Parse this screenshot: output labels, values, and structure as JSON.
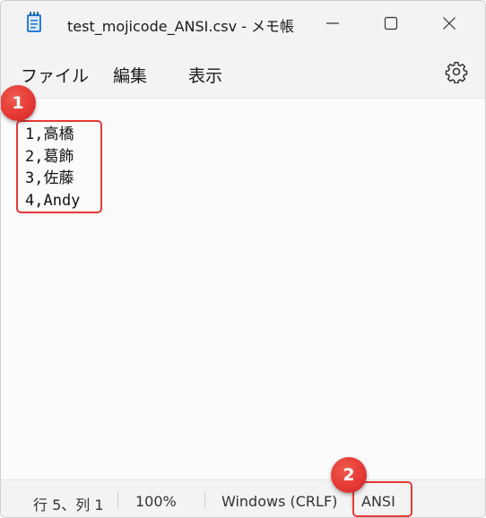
{
  "window": {
    "title": "test_mojicode_ANSI.csv - メモ帳",
    "app_icon": "notepad-icon",
    "controls": {
      "minimize_icon": "minimize-icon",
      "maximize_icon": "maximize-icon",
      "close_icon": "close-icon"
    }
  },
  "menu": {
    "items": [
      {
        "label": "ファイル"
      },
      {
        "label": "編集"
      },
      {
        "label": "表示"
      }
    ],
    "settings_icon": "gear-icon"
  },
  "editor": {
    "lines": [
      "1,高橋",
      "2,葛飾",
      "3,佐藤",
      "4,Andy"
    ]
  },
  "status": {
    "position": "行 5、列 1",
    "zoom": "100%",
    "line_ending": "Windows (CRLF)",
    "encoding": "ANSI"
  },
  "annotations": {
    "badge_1": "1",
    "badge_2": "2",
    "highlight_color": "#e53935"
  }
}
